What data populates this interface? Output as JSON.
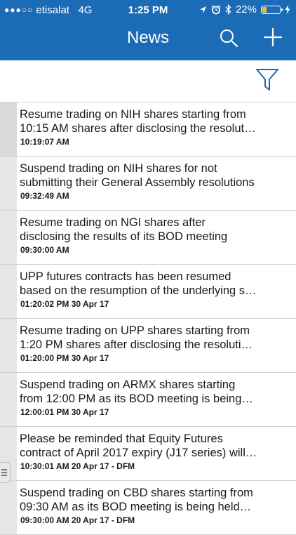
{
  "status_bar": {
    "signal_dots": "●●●○○",
    "carrier": "etisalat",
    "network": "4G",
    "time": "1:25 PM",
    "battery": "22%",
    "battery_level": 0.22,
    "icons": [
      "location-arrow-icon",
      "alarm-icon",
      "bluetooth-icon",
      "battery-icon",
      "charging-bolt-icon"
    ]
  },
  "nav": {
    "title": "News",
    "icons": [
      "search-icon",
      "plus-icon"
    ]
  },
  "filter": {
    "icon": "filter-funnel-icon"
  },
  "colors": {
    "header_bg": "#1c6bb6",
    "accent": "#1c6bb6",
    "battery_fill": "#f5c21b"
  },
  "news": [
    {
      "line1": "Resume trading on NIH shares starting from",
      "line2": "10:15 AM shares after disclosing the resolut…",
      "time": "10:19:07 AM"
    },
    {
      "line1": "Suspend trading on NIH shares for not",
      "line2": "submitting their General Assembly resolutions",
      "time": "09:32:49 AM"
    },
    {
      "line1": "Resume trading on NGI shares after",
      "line2": "disclosing the results of its BOD meeting",
      "time": "09:30:00 AM"
    },
    {
      "line1": "UPP futures contracts has been resumed",
      "line2": "based on the resumption of the underlying s…",
      "time": "01:20:02 PM 30 Apr 17"
    },
    {
      "line1": "Resume trading on UPP shares starting from",
      "line2": "1:20 PM shares after disclosing the resoluti…",
      "time": "01:20:00 PM 30 Apr 17"
    },
    {
      "line1": "Suspend trading on ARMX shares starting",
      "line2": "from 12:00 PM as its BOD meeting is being…",
      "time": "12:00:01 PM 30 Apr 17"
    },
    {
      "line1": "Please be reminded that Equity Futures",
      "line2": "contract of April 2017 expiry (J17 series) will…",
      "time": "10:30:01 AM 20 Apr 17  - DFM"
    },
    {
      "line1": "Suspend trading on CBD shares starting from",
      "line2": "09:30 AM as its BOD meeting is being held…",
      "time": "09:30:00 AM 20 Apr 17  - DFM"
    }
  ]
}
